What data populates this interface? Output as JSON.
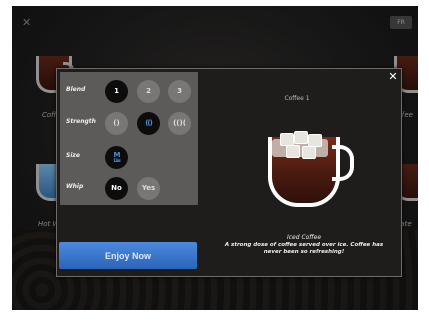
{
  "header": {
    "lang_label": "FR"
  },
  "background": {
    "items": [
      {
        "label": "Coff"
      },
      {
        "label": "offee"
      },
      {
        "label": "Hot W"
      },
      {
        "label": "ocolate"
      }
    ]
  },
  "modal": {
    "title": "Coffee 1",
    "close_label": "✕",
    "options": {
      "blend": {
        "label": "Blend",
        "choices": [
          "1",
          "2",
          "3"
        ],
        "selected": "1"
      },
      "strength": {
        "label": "Strength",
        "choices": [
          "()",
          "(()",
          "(()("
        ],
        "selected": "(()"
      },
      "size": {
        "label": "Size",
        "choices": [
          "M"
        ],
        "sub": "12oz",
        "selected": "M"
      },
      "whip": {
        "label": "Whip",
        "choices": [
          "No",
          "Yes"
        ],
        "selected": "No"
      }
    },
    "enjoy_label": "Enjoy Now",
    "drink_name": "Iced Coffee",
    "drink_description": "A strong dose of coffee served over ice. Coffee has never been so refreshing!"
  }
}
